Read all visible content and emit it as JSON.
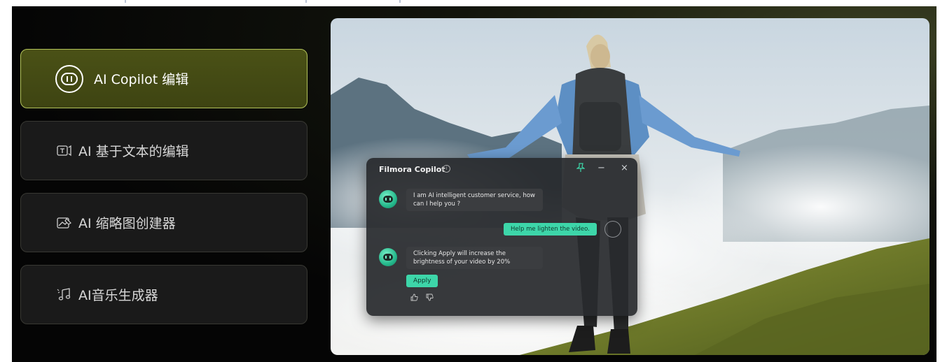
{
  "menu": {
    "items": [
      {
        "label": "AI Copilot 编辑",
        "icon": "copilot-robot-icon",
        "active": true
      },
      {
        "label": "AI 基于文本的编辑",
        "icon": "text-edit-icon",
        "active": false
      },
      {
        "label": "AI 缩略图创建器",
        "icon": "thumbnail-icon",
        "active": false
      },
      {
        "label": "AI音乐生成器",
        "icon": "music-note-icon",
        "active": false
      }
    ]
  },
  "copilot": {
    "title": "Filmora Copilot",
    "info_glyph": "i",
    "pin_icon": "pin-icon",
    "minimize_glyph": "−",
    "close_glyph": "×",
    "messages": {
      "bot_greeting": "I am AI intelligent customer service, how can I help you ?",
      "user_request": "Help me lighten the video.",
      "bot_reply": "Clicking Apply will increase the brightness of your video by 20%"
    },
    "apply_label": "Apply",
    "thumbs_up_glyph": "👍",
    "thumbs_down_glyph": "👎"
  },
  "colors": {
    "accent_green": "#3dd6a9",
    "active_card": "#4a5116",
    "active_border": "#b3c35a"
  }
}
